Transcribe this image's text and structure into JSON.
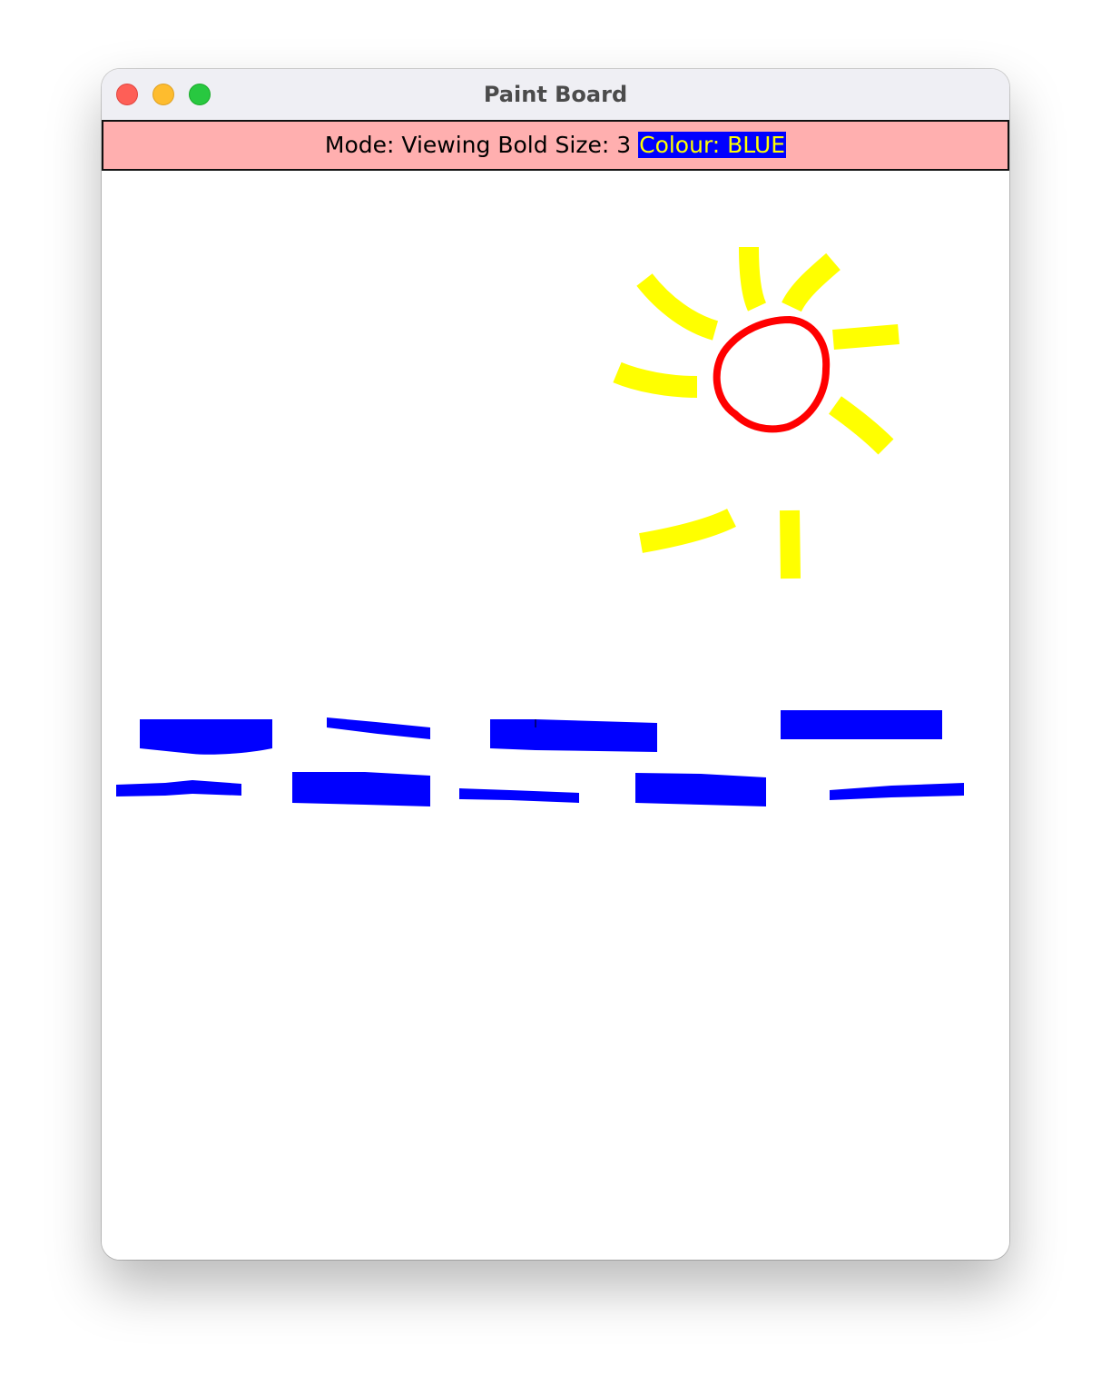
{
  "window": {
    "title": "Paint Board"
  },
  "status": {
    "mode": "Mode: Viewing",
    "bold_size": "Bold Size: 3",
    "colour": "Colour: BLUE"
  },
  "colors": {
    "status_background": "#ffafaf",
    "colour_chip_background": "#0000ff",
    "colour_chip_text": "#ffff00",
    "sun_rays": "#ffff00",
    "sun_circle": "#ff0000",
    "waves": "#0000ff"
  }
}
